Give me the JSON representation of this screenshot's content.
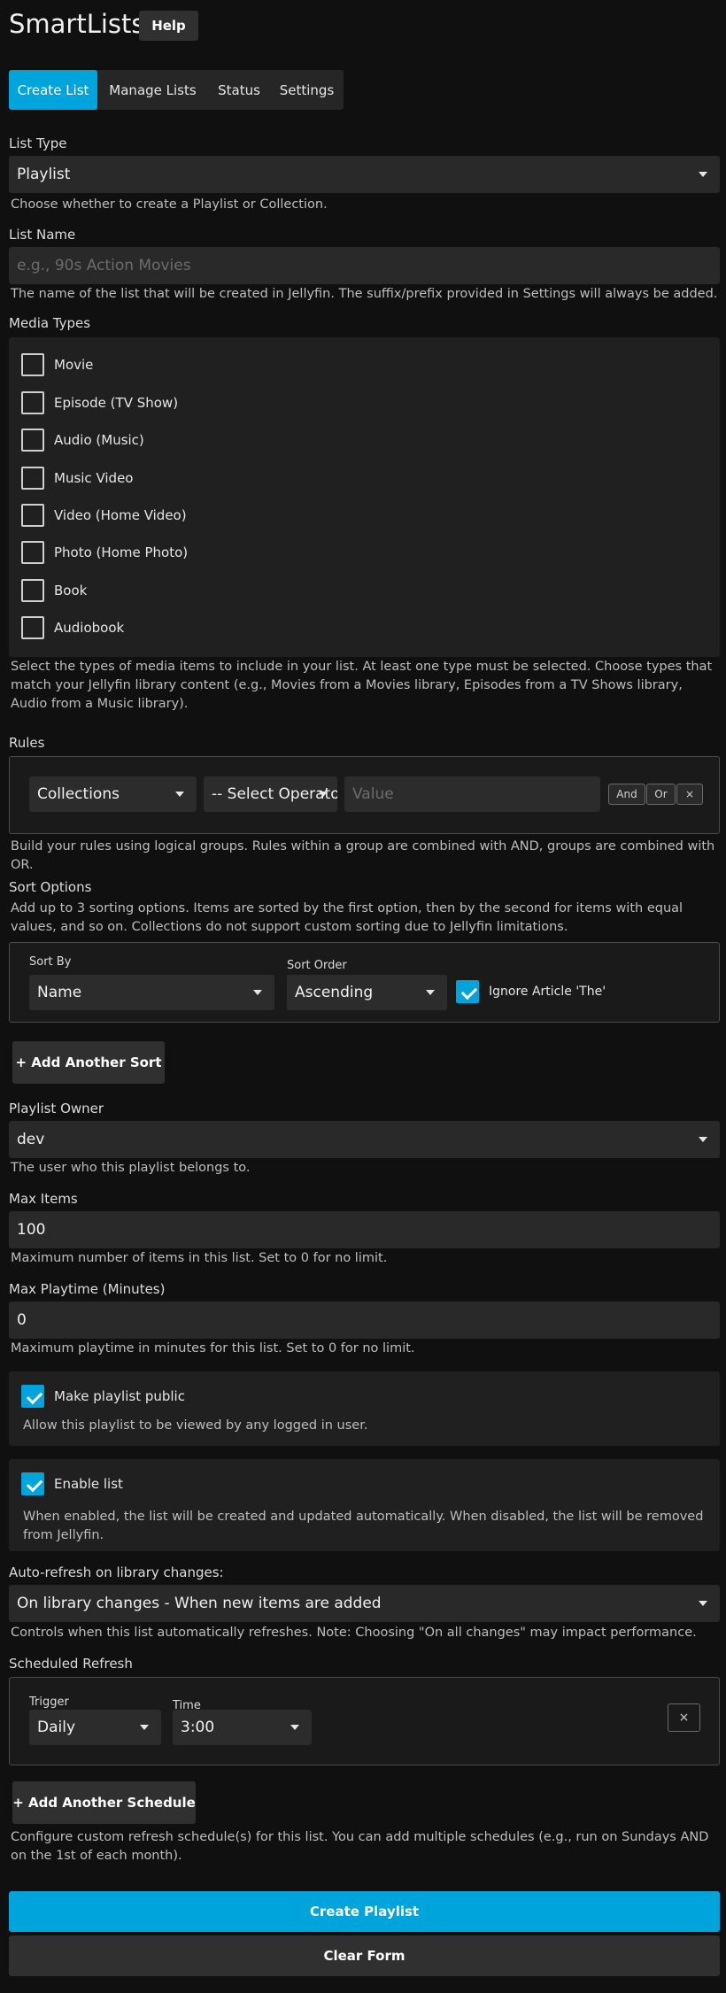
{
  "header": {
    "title": "SmartLists",
    "help_label": "Help"
  },
  "tabs": [
    {
      "label": "Create List",
      "active": true
    },
    {
      "label": "Manage Lists",
      "active": false
    },
    {
      "label": "Status",
      "active": false
    },
    {
      "label": "Settings",
      "active": false
    }
  ],
  "list_type": {
    "label": "List Type",
    "value": "Playlist",
    "help": "Choose whether to create a Playlist or Collection."
  },
  "list_name": {
    "label": "List Name",
    "placeholder": "e.g., 90s Action Movies",
    "help": "The name of the list that will be created in Jellyfin. The suffix/prefix provided in Settings will always be added."
  },
  "media_types": {
    "label": "Media Types",
    "items": [
      {
        "label": "Movie",
        "checked": false
      },
      {
        "label": "Episode (TV Show)",
        "checked": false
      },
      {
        "label": "Audio (Music)",
        "checked": false
      },
      {
        "label": "Music Video",
        "checked": false
      },
      {
        "label": "Video (Home Video)",
        "checked": false
      },
      {
        "label": "Photo (Home Photo)",
        "checked": false
      },
      {
        "label": "Book",
        "checked": false
      },
      {
        "label": "Audiobook",
        "checked": false
      }
    ],
    "help": "Select the types of media items to include in your list. At least one type must be selected. Choose types that match your Jellyfin library content (e.g., Movies from a Movies library, Episodes from a TV Shows library, Audio from a Music library)."
  },
  "rules": {
    "label": "Rules",
    "field_value": "Collections",
    "operator_value": "-- Select Operator --",
    "value_placeholder": "Value",
    "and_label": "And",
    "or_label": "Or",
    "remove_label": "×",
    "help": "Build your rules using logical groups. Rules within a group are combined with AND, groups are combined with OR."
  },
  "sort": {
    "label": "Sort Options",
    "help": "Add up to 3 sorting options. Items are sorted by the first option, then by the second for items with equal values, and so on. Collections do not support custom sorting due to Jellyfin limitations.",
    "sort_by_label": "Sort By",
    "sort_by_value": "Name",
    "sort_order_label": "Sort Order",
    "sort_order_value": "Ascending",
    "ignore_article_label": "Ignore Article 'The'",
    "ignore_article_checked": true,
    "add_label": "+ Add Another Sort"
  },
  "owner": {
    "label": "Playlist Owner",
    "value": "dev",
    "help": "The user who this playlist belongs to."
  },
  "max_items": {
    "label": "Max Items",
    "value": "100",
    "help": "Maximum number of items in this list. Set to 0 for no limit."
  },
  "max_playtime": {
    "label": "Max Playtime (Minutes)",
    "value": "0",
    "help": "Maximum playtime in minutes for this list. Set to 0 for no limit."
  },
  "public": {
    "label": "Make playlist public",
    "checked": true,
    "help": "Allow this playlist to be viewed by any logged in user."
  },
  "enable": {
    "label": "Enable list",
    "checked": true,
    "help": "When enabled, the list will be created and updated automatically. When disabled, the list will be removed from Jellyfin."
  },
  "auto_refresh": {
    "label": "Auto-refresh on library changes:",
    "value": "On library changes - When new items are added",
    "help": "Controls when this list automatically refreshes. Note: Choosing \"On all changes\" may impact performance."
  },
  "schedule": {
    "label": "Scheduled Refresh",
    "trigger_label": "Trigger",
    "trigger_value": "Daily",
    "time_label": "Time",
    "time_value": "3:00",
    "remove_label": "×",
    "add_label": "+ Add Another Schedule",
    "help": "Configure custom refresh schedule(s) for this list. You can add multiple schedules (e.g., run on Sundays AND on the 1st of each month)."
  },
  "actions": {
    "create_label": "Create Playlist",
    "clear_label": "Clear Form"
  },
  "colors": {
    "accent": "#00a4dc",
    "background": "#101010",
    "field": "#292929"
  }
}
